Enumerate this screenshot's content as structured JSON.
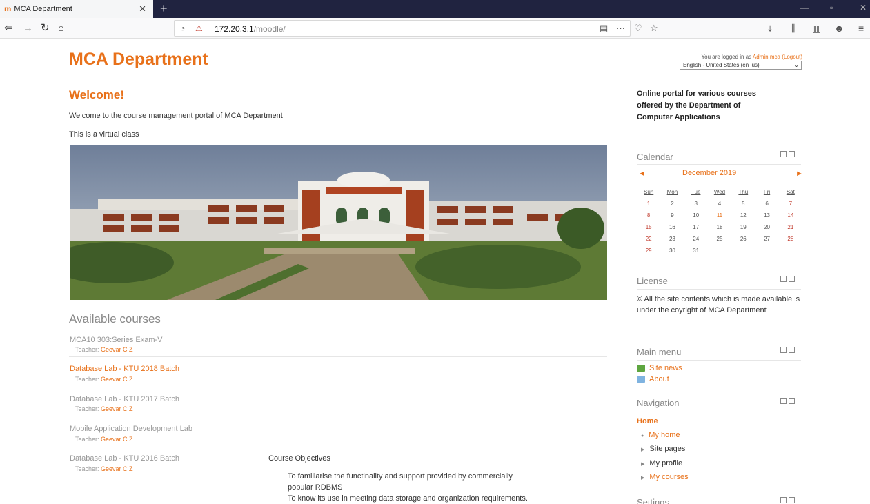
{
  "browser": {
    "tab_title": "MCA Department",
    "tab_favicon": "m",
    "url_host": "172.20.3.1",
    "url_path": "/moodle/",
    "accent": "#e8711a"
  },
  "page": {
    "site_title": "MCA Department",
    "login": {
      "prefix": "You are logged in as",
      "user": "Admin mca",
      "logout": "(Logout)"
    },
    "language": "English - United States (en_us)",
    "welcome_heading": "Welcome!",
    "welcome_text": "Welcome to the course management portal of MCA Department",
    "virtual_text": "This is a virtual class"
  },
  "courses": {
    "heading": "Available courses",
    "teacher_label": "Teacher:",
    "items": [
      {
        "name": "MCA10 303:Series Exam-V",
        "teacher": "Geevar C Z"
      },
      {
        "name": "Database Lab - KTU 2018 Batch",
        "teacher": "Geevar C Z"
      },
      {
        "name": "Database Lab - KTU 2017 Batch",
        "teacher": "Geevar C Z"
      },
      {
        "name": "Mobile Application Development Lab",
        "teacher": "Geevar C Z"
      },
      {
        "name": "Database Lab - KTU 2016 Batch",
        "teacher": "Geevar C Z"
      }
    ],
    "objectives": {
      "heading": "Course Objectives",
      "lines": [
        "To familiarise the functinality and support provided by commercially",
        "popular RDBMS",
        "To know its use in meeting data storage and organization requirements."
      ]
    }
  },
  "sidebar": {
    "description": "Online portal for various courses offered by the Department of Computer Applications",
    "calendar": {
      "title": "Calendar",
      "month": "December 2019",
      "prev": "◄",
      "next": "►",
      "days": [
        "Sun",
        "Mon",
        "Tue",
        "Wed",
        "Thu",
        "Fri",
        "Sat"
      ],
      "weeks": [
        [
          "1",
          "2",
          "3",
          "4",
          "5",
          "6",
          "7"
        ],
        [
          "8",
          "9",
          "10",
          "11",
          "12",
          "13",
          "14"
        ],
        [
          "15",
          "16",
          "17",
          "18",
          "19",
          "20",
          "21"
        ],
        [
          "22",
          "23",
          "24",
          "25",
          "26",
          "27",
          "28"
        ],
        [
          "29",
          "30",
          "31",
          "",
          "",
          "",
          ""
        ]
      ]
    },
    "license": {
      "title": "License",
      "text": "© All the site contents which is made available is under the coyright of MCA Department"
    },
    "main_menu": {
      "title": "Main menu",
      "items": [
        "Site news",
        "About"
      ]
    },
    "navigation": {
      "title": "Navigation",
      "home": "Home",
      "items": [
        "My home",
        "Site pages",
        "My profile",
        "My courses"
      ]
    },
    "settings": {
      "title": "Settings"
    }
  }
}
